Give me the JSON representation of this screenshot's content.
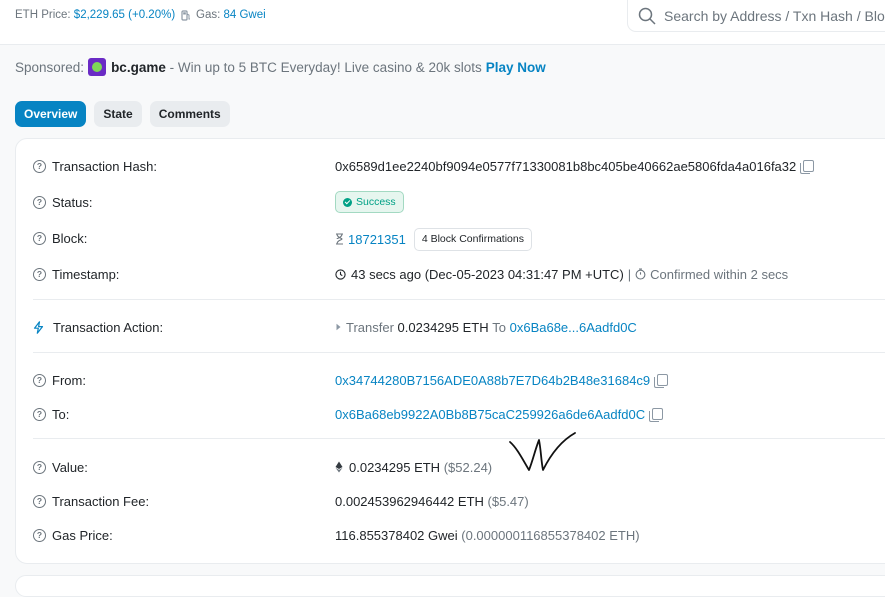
{
  "topbar": {
    "eth_price_label": "ETH Price:",
    "eth_price_value": "$2,229.65",
    "eth_price_change": "(+0.20%)",
    "gas_label": "Gas:",
    "gas_value": "84 Gwei",
    "search_placeholder": "Search by Address / Txn Hash / Block"
  },
  "sponsored": {
    "label": "Sponsored:",
    "brand": "bc.game",
    "text": "- Win up to 5 BTC Everyday! Live casino & 20k slots",
    "cta": "Play Now"
  },
  "tabs": [
    {
      "label": "Overview",
      "active": true
    },
    {
      "label": "State",
      "active": false
    },
    {
      "label": "Comments",
      "active": false
    }
  ],
  "details": {
    "tx_hash_label": "Transaction Hash:",
    "tx_hash_value": "0x6589d1ee2240bf9094e0577f71330081b8bc405be40662ae5806fda4a016fa32",
    "status_label": "Status:",
    "status_value": "Success",
    "block_label": "Block:",
    "block_value": "18721351",
    "block_confirmations": "4 Block Confirmations",
    "timestamp_label": "Timestamp:",
    "timestamp_value": "43 secs ago (Dec-05-2023 04:31:47 PM +UTC)",
    "timestamp_separator": "|",
    "confirmed_within": "Confirmed within 2 secs",
    "action_label": "Transaction Action:",
    "action_prefix": "Transfer",
    "action_amount": "0.0234295 ETH",
    "action_to": "To",
    "action_address": "0x6Ba68e...6Aadfd0C",
    "from_label": "From:",
    "from_value": "0x34744280B7156ADE0A88b7E7D64b2B48e31684c9",
    "to_label": "To:",
    "to_value": "0x6Ba68eb9922A0Bb8B75caC259926a6de6Aadfd0C",
    "value_label": "Value:",
    "value_eth": "0.0234295 ETH",
    "value_usd": "($52.24)",
    "fee_label": "Transaction Fee:",
    "fee_eth": "0.002453962946442 ETH",
    "fee_usd": "($5.47)",
    "gas_price_label": "Gas Price:",
    "gas_price_gwei": "116.855378402 Gwei",
    "gas_price_eth": "(0.000000116855378402 ETH)"
  },
  "icons": {
    "help": "question-circle-icon",
    "search": "search-icon",
    "copy": "copy-icon",
    "gas": "gas-pump-icon",
    "hourglass": "hourglass-icon",
    "clock": "clock-icon",
    "stopwatch": "stopwatch-icon",
    "lightning": "lightning-icon",
    "caret": "caret-right-icon",
    "eth": "ethereum-icon"
  },
  "colors": {
    "link": "#0784c3",
    "success": "#00a186",
    "muted": "#6c757d"
  }
}
